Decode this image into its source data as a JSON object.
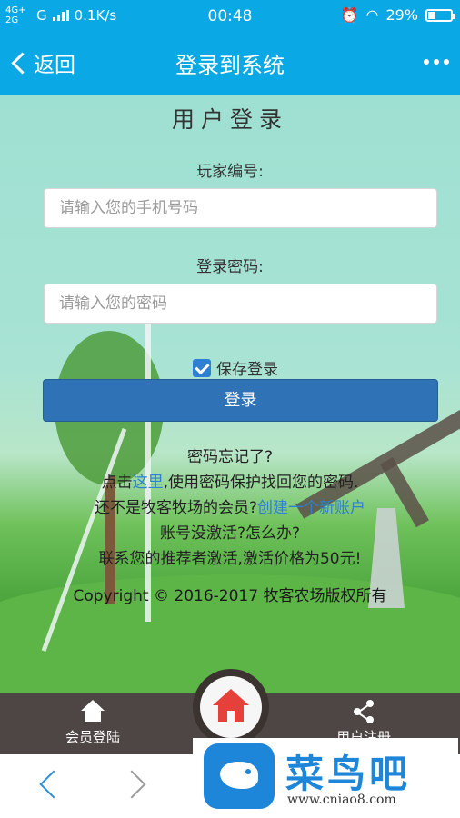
{
  "status": {
    "network": "4G+ 2G",
    "carrier_g": "G",
    "speed": "0.1K/s",
    "time": "00:48",
    "battery": "29%",
    "battery_level": 0.29
  },
  "nav": {
    "back": "返回",
    "title": "登录到系统"
  },
  "form": {
    "heading": "用户登录",
    "account_label": "玩家编号:",
    "account_placeholder": "请输入您的手机号码",
    "password_label": "登录密码:",
    "password_placeholder": "请输入您的密码",
    "remember_label": "保存登录",
    "remember_checked": true,
    "login_button": "登录"
  },
  "info": {
    "forgot": "密码忘记了?",
    "recover_prefix": "点击",
    "recover_link": "这里",
    "recover_suffix": ",使用密码保护找回您的密码.",
    "member_prefix": "还不是牧客牧场的会员?",
    "member_link": "创建一个新账户",
    "activate_question": "账号没激活?怎么办?",
    "activate_answer": "联系您的推荐者激活,激活价格为50元!",
    "copyright": "Copyright © 2016-2017 牧客农场版权所有"
  },
  "tabbar": {
    "left": "会员登陆",
    "right": "用户注册"
  },
  "watermark": {
    "brand": "菜鸟吧",
    "url": "www.cniao8.com"
  },
  "colors": {
    "accent": "#0aa9e6",
    "button": "#2f72b5",
    "link": "#2f7fd3",
    "tabbar": "#4e4644"
  }
}
